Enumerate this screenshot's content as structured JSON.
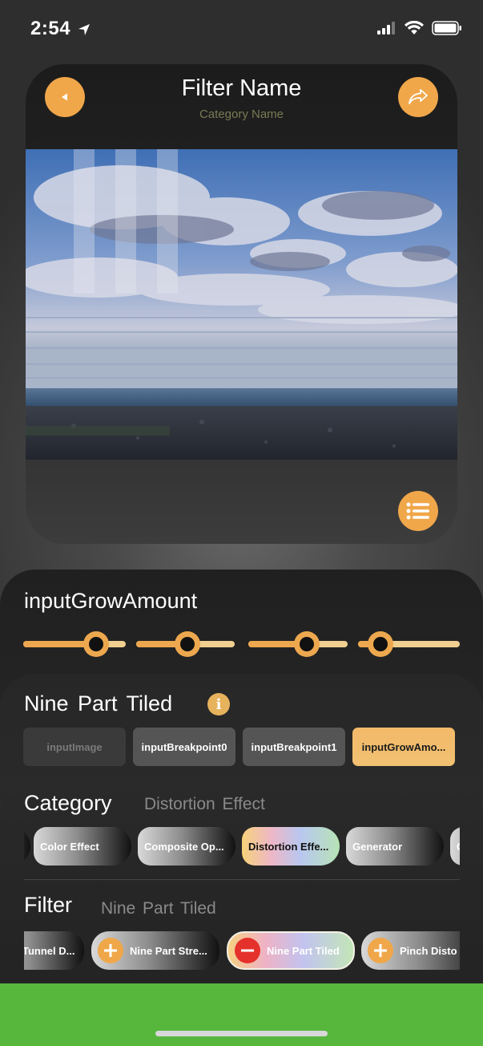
{
  "status_bar": {
    "time": "2:54"
  },
  "header": {
    "title": "Filter Name",
    "subtitle": "Category Name"
  },
  "slider_panel": {
    "title": "inputGrowAmount",
    "sliders": [
      {
        "value": 0.78
      },
      {
        "value": 0.53
      },
      {
        "value": 0.62
      },
      {
        "value": 0.13
      }
    ]
  },
  "filter_panel": {
    "title": "Nine Part Tiled",
    "params": [
      {
        "label": "inputImage",
        "state": "disabled"
      },
      {
        "label": "inputBreakpoint0",
        "state": "normal"
      },
      {
        "label": "inputBreakpoint1",
        "state": "normal"
      },
      {
        "label": "inputGrowAmo...",
        "state": "selected"
      }
    ]
  },
  "category_row": {
    "label": "Category",
    "value": "Distortion Effect",
    "chips": [
      {
        "label": "",
        "selected": false
      },
      {
        "label": "Color Effect",
        "selected": false
      },
      {
        "label": "Composite Op...",
        "selected": false
      },
      {
        "label": "Distortion Effe...",
        "selected": true
      },
      {
        "label": "Generator",
        "selected": false
      },
      {
        "label": "G",
        "selected": false
      }
    ]
  },
  "filter_row": {
    "label": "Filter",
    "value": "Nine Part Tiled",
    "chips": [
      {
        "label": "Tunnel D...",
        "icon": "none",
        "selected": false
      },
      {
        "label": "Nine Part Stre...",
        "icon": "plus",
        "selected": false
      },
      {
        "label": "Nine Part Tiled",
        "icon": "minus",
        "selected": true
      },
      {
        "label": "Pinch Disto",
        "icon": "plus",
        "selected": false
      }
    ]
  },
  "colors": {
    "accent": "#f0a74a",
    "remove": "#e5312b",
    "bottom_bar": "#57b73d"
  }
}
